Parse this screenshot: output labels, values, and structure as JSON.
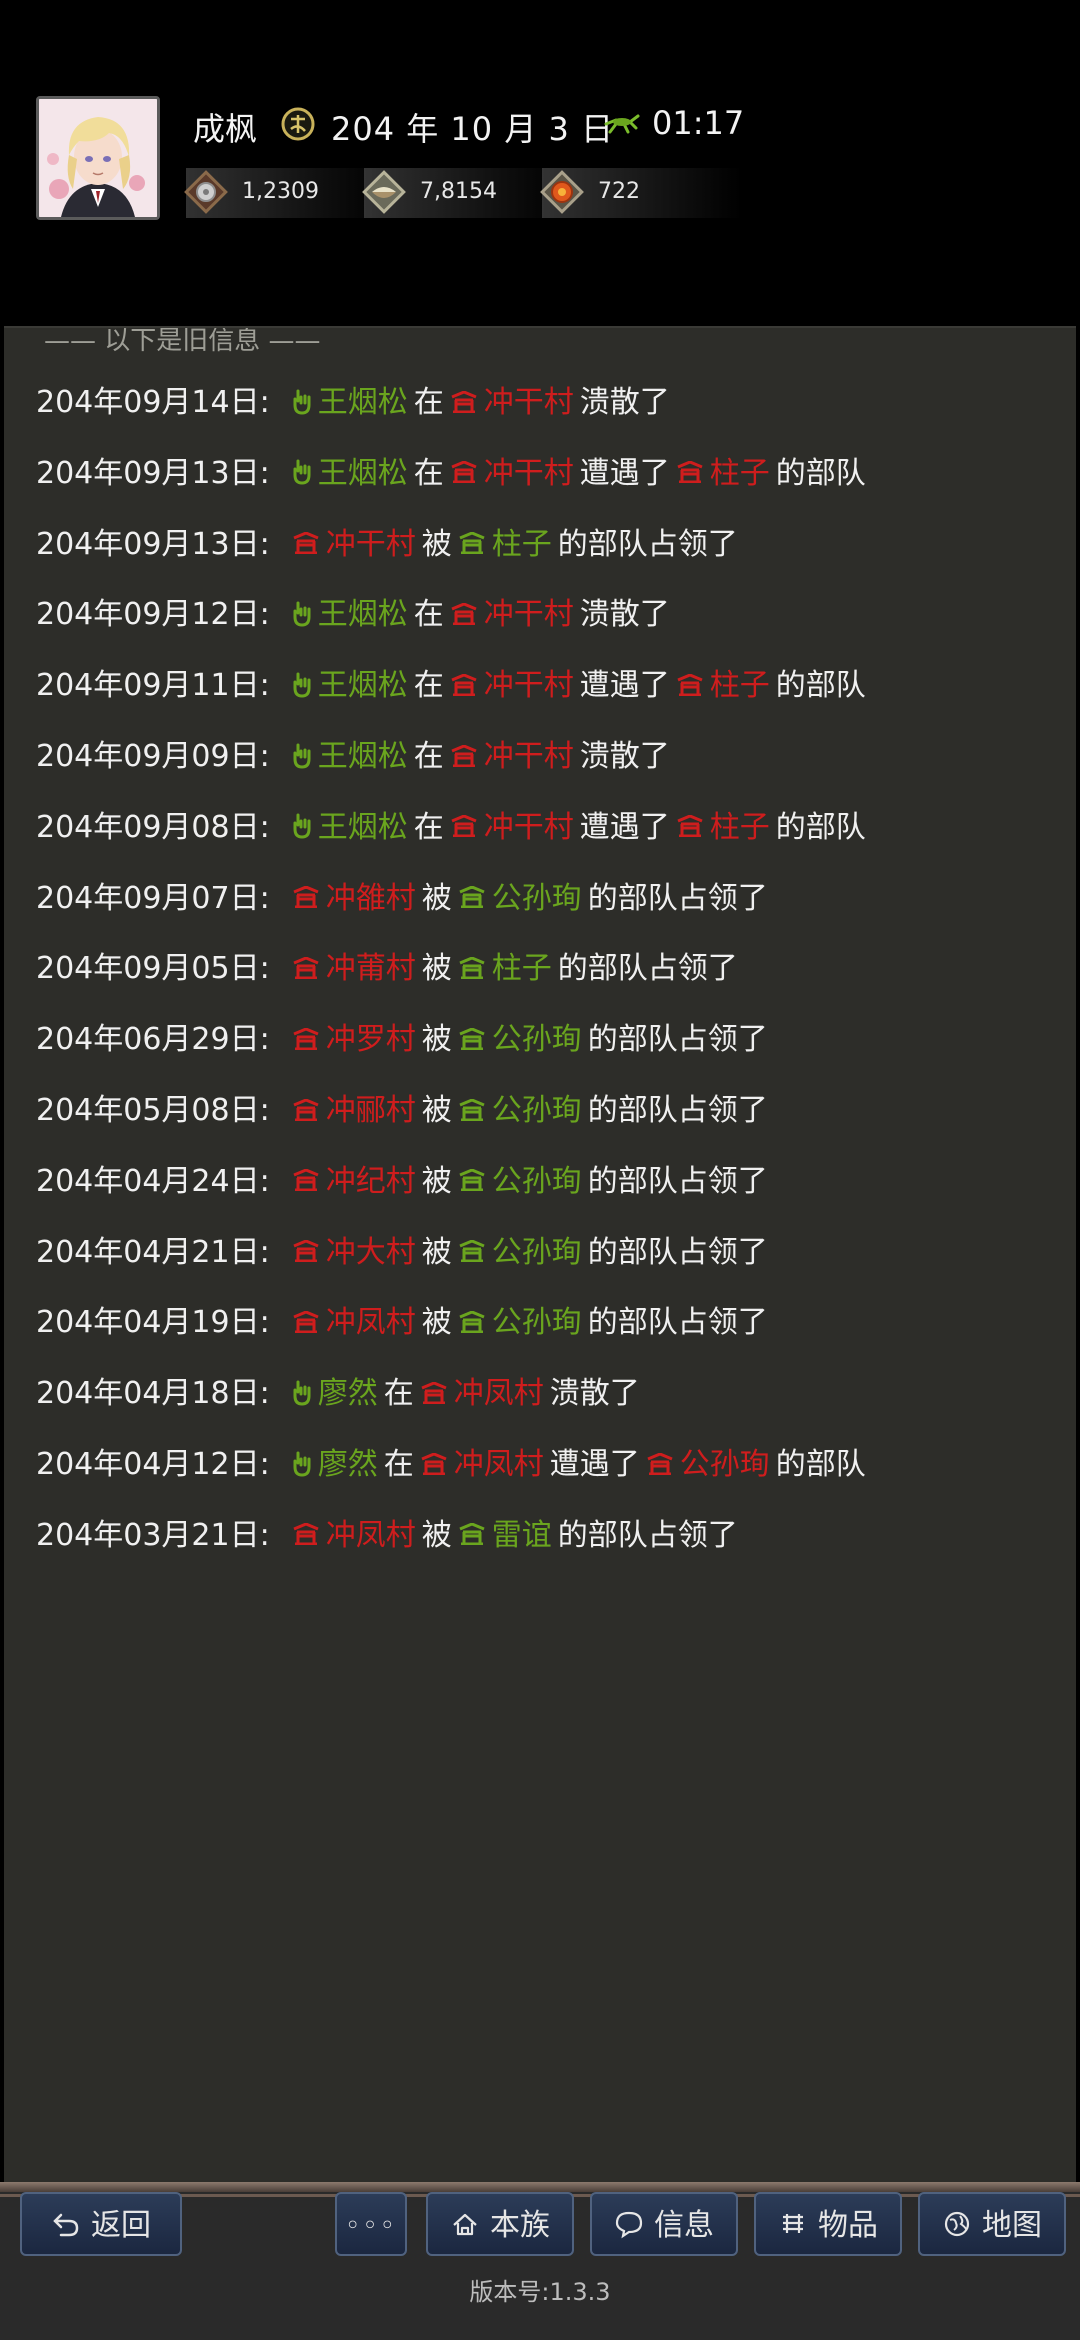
{
  "header": {
    "player_name": "成枫",
    "date": "204 年 10 月 3 日",
    "time": "01:17",
    "resources": [
      {
        "icon": "silver-coin-icon",
        "value": "1,2309"
      },
      {
        "icon": "grain-bowl-icon",
        "value": "7,8154"
      },
      {
        "icon": "orange-token-icon",
        "value": "722"
      }
    ]
  },
  "panel": {
    "old_info_label": "以下是旧信息",
    "entries": [
      {
        "date": "204年09月14日:",
        "actor": "王烟松",
        "actor_type": "person",
        "verb1": "在",
        "target": "冲干村",
        "verb2": "溃散了"
      },
      {
        "date": "204年09月13日:",
        "actor": "王烟松",
        "verb1": "在",
        "target": "冲干村",
        "verb2": "遭遇了",
        "enemy": "柱子",
        "suffix": "的部队"
      },
      {
        "date": "204年09月13日:",
        "village": "冲干村",
        "verb1": "被",
        "captor": "柱子",
        "suffix": "的部队占领了"
      },
      {
        "date": "204年09月12日:",
        "actor": "王烟松",
        "verb1": "在",
        "target": "冲干村",
        "verb2": "溃散了"
      },
      {
        "date": "204年09月11日:",
        "actor": "王烟松",
        "verb1": "在",
        "target": "冲干村",
        "verb2": "遭遇了",
        "enemy": "柱子",
        "suffix": "的部队"
      },
      {
        "date": "204年09月09日:",
        "actor": "王烟松",
        "verb1": "在",
        "target": "冲干村",
        "verb2": "溃散了"
      },
      {
        "date": "204年09月08日:",
        "actor": "王烟松",
        "verb1": "在",
        "target": "冲干村",
        "verb2": "遭遇了",
        "enemy": "柱子",
        "suffix": "的部队"
      },
      {
        "date": "204年09月07日:",
        "village": "冲雒村",
        "verb1": "被",
        "captor": "公孙珣",
        "suffix": "的部队占领了"
      },
      {
        "date": "204年09月05日:",
        "village": "冲莆村",
        "verb1": "被",
        "captor": "柱子",
        "suffix": "的部队占领了"
      },
      {
        "date": "204年06月29日:",
        "village": "冲罗村",
        "verb1": "被",
        "captor": "公孙珣",
        "suffix": "的部队占领了"
      },
      {
        "date": "204年05月08日:",
        "village": "冲郦村",
        "verb1": "被",
        "captor": "公孙珣",
        "suffix": "的部队占领了"
      },
      {
        "date": "204年04月24日:",
        "village": "冲纪村",
        "verb1": "被",
        "captor": "公孙珣",
        "suffix": "的部队占领了"
      },
      {
        "date": "204年04月21日:",
        "village": "冲大村",
        "verb1": "被",
        "captor": "公孙珣",
        "suffix": "的部队占领了"
      },
      {
        "date": "204年04月19日:",
        "village": "冲凤村",
        "verb1": "被",
        "captor": "公孙珣",
        "suffix": "的部队占领了"
      },
      {
        "date": "204年04月18日:",
        "actor": "廖然",
        "verb1": "在",
        "target": "冲凤村",
        "verb2": "溃散了"
      },
      {
        "date": "204年04月12日:",
        "actor": "廖然",
        "verb1": "在",
        "target": "冲凤村",
        "verb2": "遭遇了",
        "enemy": "公孙珣",
        "suffix": "的部队"
      },
      {
        "date": "204年03月21日:",
        "village": "冲凤村",
        "verb1": "被",
        "captor": "雷谊",
        "suffix": "的部队占领了"
      }
    ]
  },
  "bottom_bar": {
    "back_label": "返回",
    "more_label": "◦◦◦",
    "clan_label": "本族",
    "info_label": "信息",
    "items_label": "物品",
    "map_label": "地图",
    "version": "版本号:1.3.3"
  },
  "colors": {
    "friendly": "#6aa51e",
    "hostile": "#cf1d1d",
    "panel_bg": "#2d2d29"
  }
}
